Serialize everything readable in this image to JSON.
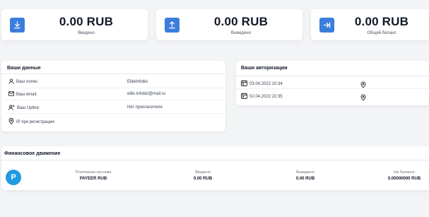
{
  "stats": [
    {
      "value": "0.00 RUB",
      "label": "Введено",
      "icon": "download-icon"
    },
    {
      "value": "0.00 RUB",
      "label": "Выведено",
      "icon": "upload-icon"
    },
    {
      "value": "0.00 RUB",
      "label": "Общий баланс",
      "icon": "arrow-to-line-icon"
    }
  ],
  "user_data": {
    "title": "Ваши данные",
    "rows": [
      {
        "label": "Ваш логин:",
        "value": "EliteInfobiz",
        "icon": "user-icon"
      },
      {
        "label": "Ваш email:",
        "value": "elite.infobiz@mail.ru",
        "icon": "envelope-icon"
      },
      {
        "label": "Ваш Upline:",
        "value": "Нет пригласителя",
        "icon": "user-plus-icon"
      },
      {
        "label": "IP при регистрации:",
        "value": "",
        "icon": "map-pin-icon"
      }
    ]
  },
  "authorizations": {
    "title": "Ваши авторизации",
    "rows": [
      {
        "date": "03.04.2022 10:34",
        "icon": "calendar-icon",
        "location_icon": "map-pin-icon"
      },
      {
        "date": "02.04.2022 22:35",
        "icon": "calendar-icon",
        "location_icon": "map-pin-icon"
      }
    ]
  },
  "finance": {
    "title": "Финансовое движение",
    "row": {
      "logo_letter": "P",
      "system_label": "Платёжная система",
      "system_value": "PAYEER RUB",
      "in_label": "Введено",
      "in_value": "0.00 RUB",
      "out_label": "Выведено",
      "out_value": "0.00 RUB",
      "balance_label": "На балансе",
      "balance_value": "0.00000000 RUB"
    }
  },
  "colors": {
    "accent": "#3b7ddd",
    "payeer": "#1e9be0"
  }
}
